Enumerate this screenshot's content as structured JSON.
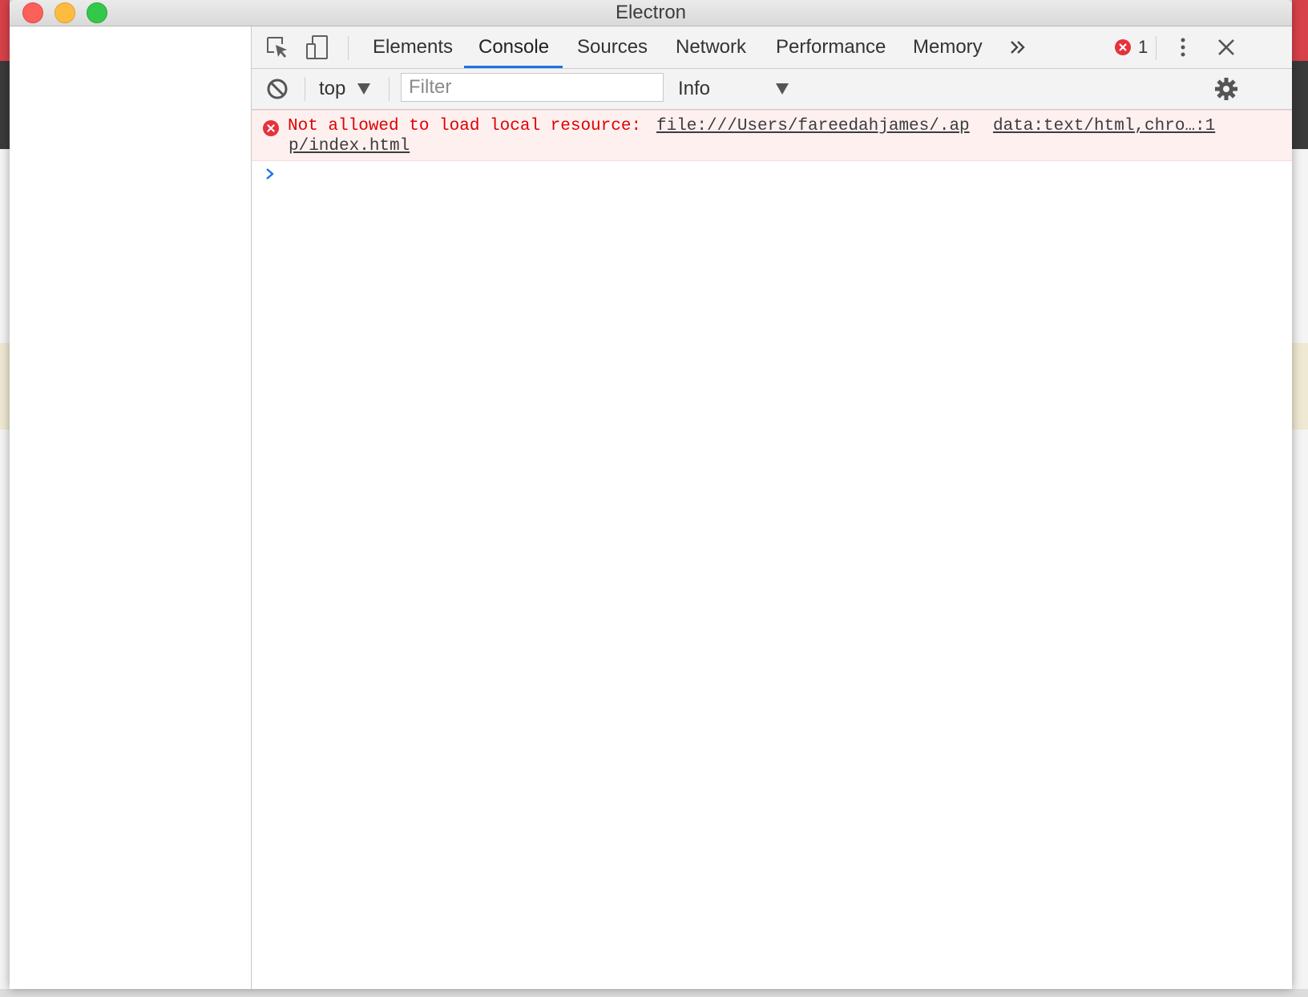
{
  "window": {
    "title": "Electron"
  },
  "devtools": {
    "tabs": [
      {
        "label": "Elements",
        "active": false
      },
      {
        "label": "Console",
        "active": true
      },
      {
        "label": "Sources",
        "active": false
      },
      {
        "label": "Network",
        "active": false
      },
      {
        "label": "Performance",
        "active": false
      },
      {
        "label": "Memory",
        "active": false
      }
    ],
    "error_count": "1",
    "accent_color": "#1a73e8"
  },
  "console_toolbar": {
    "context": "top",
    "filter_placeholder": "Filter",
    "filter_value": "",
    "level": "Info"
  },
  "console": {
    "messages": [
      {
        "type": "error",
        "text": "Not allowed to load local resource:",
        "url_line1": "file:///Users/fareedahjames/.ap",
        "url_line2": "p/index.html",
        "source": "data:text/html,chro…:1",
        "color": "#e00000"
      }
    ]
  }
}
